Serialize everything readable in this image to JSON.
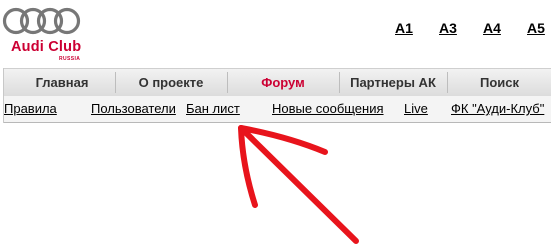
{
  "header": {
    "logo": {
      "name": "Audi Club",
      "sub": "RUSSIA"
    },
    "models": [
      "A1",
      "A3",
      "A4",
      "A5"
    ]
  },
  "nav": {
    "items": [
      {
        "label": "Главная"
      },
      {
        "label": "О проекте"
      },
      {
        "label": "Форум",
        "active": true
      },
      {
        "label": "Партнеры АК"
      },
      {
        "label": "Поиск"
      }
    ]
  },
  "subnav": {
    "items": [
      {
        "label": "Правила"
      },
      {
        "label": "Пользователи"
      },
      {
        "label": "Бан лист"
      },
      {
        "label": "Новые сообщения"
      },
      {
        "label": "Live"
      },
      {
        "label": "ФК \"Ауди-Клуб\""
      }
    ]
  },
  "colors": {
    "accent": "#cc0033",
    "arrow": "#e8141c"
  }
}
